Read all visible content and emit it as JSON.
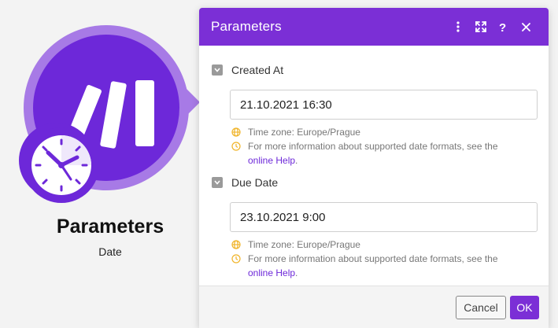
{
  "node": {
    "title": "Parameters",
    "subtitle": "Date",
    "icon": "make-logo-icon",
    "badge_icon": "clock-icon"
  },
  "dialog": {
    "title": "Parameters",
    "header_icons": [
      "more-vertical-icon",
      "expand-icon",
      "help-icon",
      "close-icon"
    ],
    "fields": [
      {
        "label": "Created At",
        "value": "21.10.2021 16:30",
        "timezone_hint": "Time zone: Europe/Prague",
        "format_hint": "For more information about supported date formats, see the",
        "help_link": "online Help",
        "help_suffix": "."
      },
      {
        "label": "Due Date",
        "value": "23.10.2021 9:00",
        "timezone_hint": "Time zone: Europe/Prague",
        "format_hint": "For more information about supported date formats, see the",
        "help_link": "online Help",
        "help_suffix": "."
      }
    ],
    "footer": {
      "cancel_label": "Cancel",
      "ok_label": "OK"
    }
  },
  "colors": {
    "accent": "#7b2fd6",
    "node_inner": "#6d28d9",
    "node_outer": "#a77ae6",
    "hint_icon": "#f0b429"
  }
}
